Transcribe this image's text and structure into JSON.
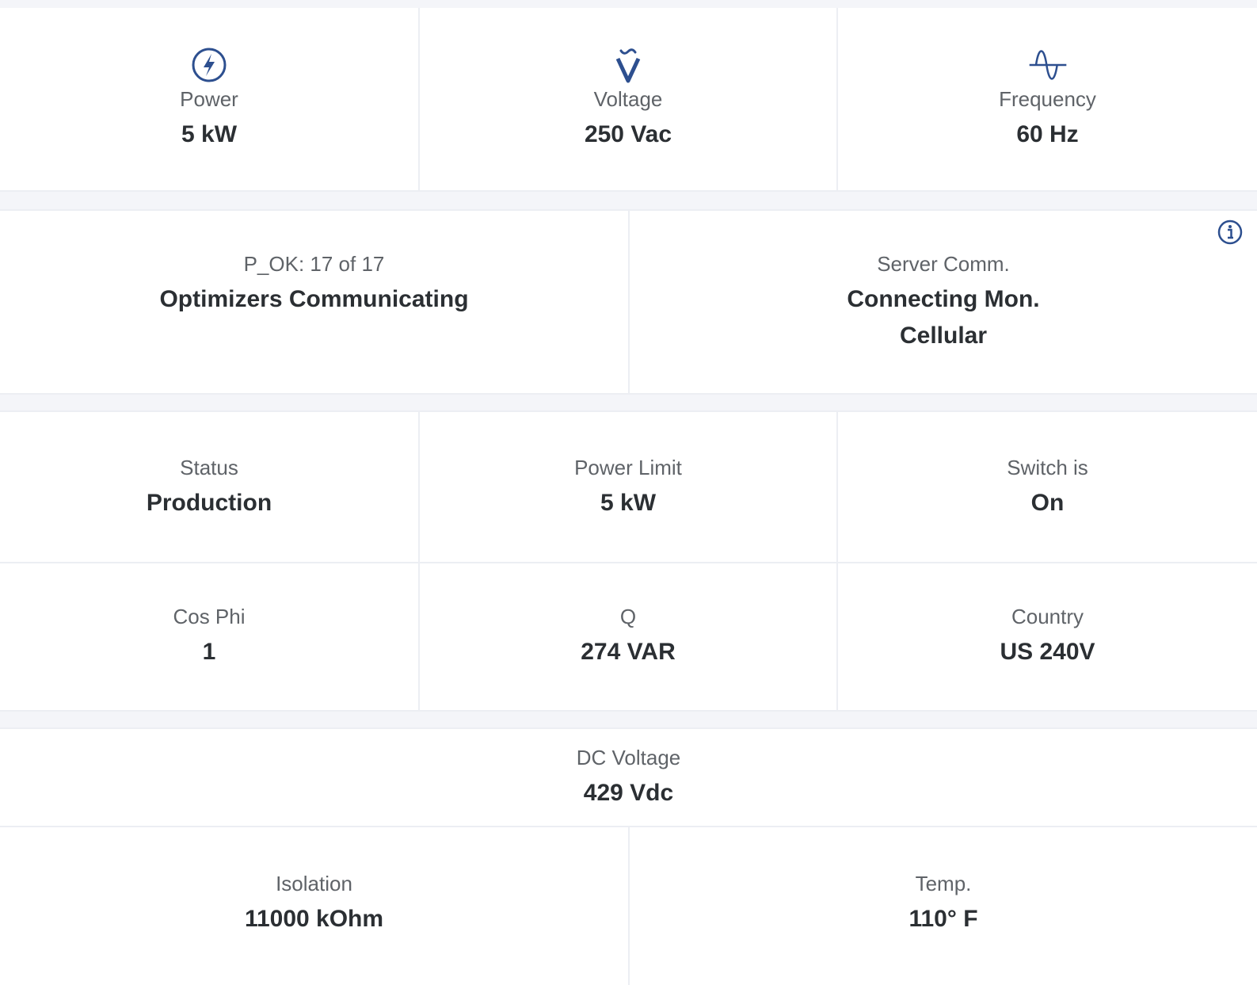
{
  "ac": {
    "power": {
      "label": "Power",
      "value": "5 kW",
      "icon": "lightning-icon"
    },
    "voltage": {
      "label": "Voltage",
      "value": "250 Vac",
      "icon": "ac-voltage-icon"
    },
    "frequency": {
      "label": "Frequency",
      "value": "60 Hz",
      "icon": "sine-wave-icon"
    }
  },
  "comm": {
    "optimizers": {
      "label": "P_OK: 17 of 17",
      "value": "Optimizers Communicating"
    },
    "server": {
      "label": "Server Comm.",
      "value": "Connecting Mon.",
      "value2": "Cellular",
      "icon": "info-icon"
    }
  },
  "status": {
    "status": {
      "label": "Status",
      "value": "Production"
    },
    "power_limit": {
      "label": "Power Limit",
      "value": "5 kW"
    },
    "switch": {
      "label": "Switch is",
      "value": "On"
    },
    "cos_phi": {
      "label": "Cos Phi",
      "value": "1"
    },
    "q": {
      "label": "Q",
      "value": "274 VAR"
    },
    "country": {
      "label": "Country",
      "value": "US 240V"
    }
  },
  "dc": {
    "dc_voltage": {
      "label": "DC Voltage",
      "value": "429 Vdc"
    },
    "isolation": {
      "label": "Isolation",
      "value": "11000 kOhm"
    },
    "temp": {
      "label": "Temp.",
      "value": "110° F"
    }
  },
  "colors": {
    "icon": "#2d4f8f",
    "label": "#5f6368",
    "value": "#2b2f33",
    "divider": "#eceef3",
    "background": "#f4f5f9"
  }
}
